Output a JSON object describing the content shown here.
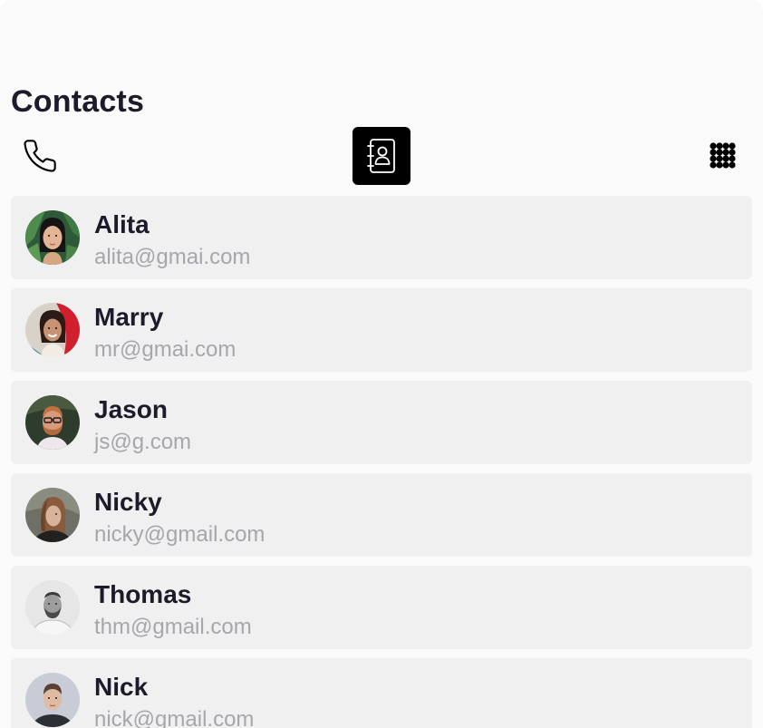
{
  "header": {
    "title": "Contacts"
  },
  "tabs": [
    {
      "icon": "phone-icon",
      "active": false
    },
    {
      "icon": "contact-book-icon",
      "active": true
    },
    {
      "icon": "dialpad-icon",
      "active": false
    }
  ],
  "colors": {
    "background": "#fafafa",
    "card": "#f0f0f0",
    "title": "#1b1b2a",
    "email": "#a6a6ac",
    "active_tab": "#000000"
  },
  "contacts": [
    {
      "name": "Alita",
      "email": "alita@gmai.com"
    },
    {
      "name": "Marry",
      "email": "mr@gmai.com"
    },
    {
      "name": "Jason",
      "email": "js@g.com"
    },
    {
      "name": "Nicky",
      "email": "nicky@gmail.com"
    },
    {
      "name": "Thomas",
      "email": "thm@gmail.com"
    },
    {
      "name": "Nick",
      "email": "nick@gmail.com"
    }
  ]
}
